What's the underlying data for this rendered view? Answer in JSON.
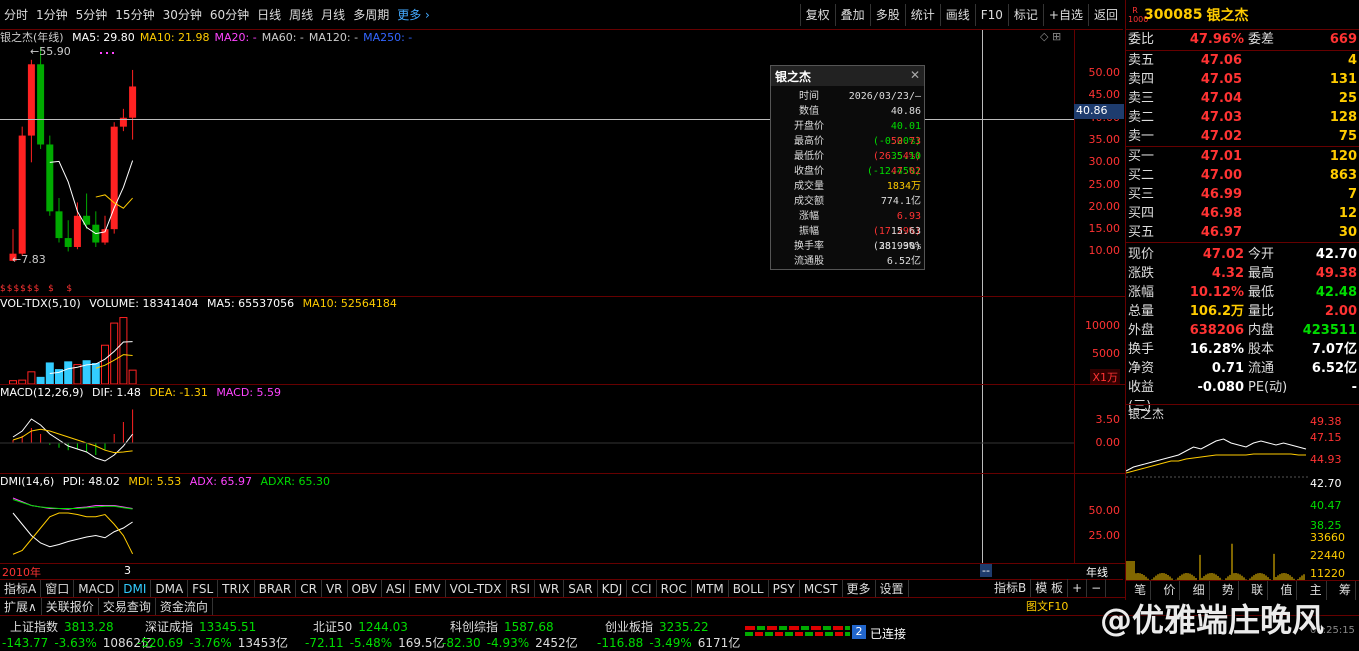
{
  "toolbar": {
    "timeframes": [
      "分时",
      "1分钟",
      "5分钟",
      "15分钟",
      "30分钟",
      "60分钟",
      "日线",
      "周线",
      "月线",
      "多周期"
    ],
    "more": "更多",
    "tools": [
      "复权",
      "叠加",
      "多股",
      "统计",
      "画线",
      "F10",
      "标记",
      "+自选",
      "返回"
    ]
  },
  "main": {
    "name": "银之杰(年线)",
    "ma": [
      {
        "label": "MA5: 29.80",
        "color": "#ffffff"
      },
      {
        "label": "MA10: 21.98",
        "color": "#ffcc00"
      },
      {
        "label": "MA20: -",
        "color": "#ff44ff"
      },
      {
        "label": "MA60: -",
        "color": "#cccccc"
      },
      {
        "label": "MA120: -",
        "color": "#cccccc"
      },
      {
        "label": "MA250: -",
        "color": "#3366ff"
      }
    ],
    "high_label": "55.90",
    "low_label": "7.83",
    "axis": [
      "50.00",
      "45.00",
      "40.00",
      "35.00",
      "30.00",
      "25.00",
      "20.00",
      "15.00",
      "10.00"
    ],
    "cursor_value": "40.86"
  },
  "vol": {
    "title": "VOL-TDX(5,10)",
    "volume": "VOLUME: 18341404",
    "ma5": "MA5: 65537056",
    "ma10": "MA10: 52564184",
    "axis": [
      "10000",
      "5000"
    ],
    "unit": "X1万"
  },
  "macd": {
    "title": "MACD(12,26,9)",
    "dif": "DIF: 1.48",
    "dea": "DEA: -1.31",
    "macd": "MACD: 5.59",
    "axis": [
      "3.50",
      "0.00"
    ]
  },
  "dmi": {
    "title": "DMI(14,6)",
    "pdi": "PDI: 48.02",
    "mdi": "MDI: 5.53",
    "adx": "ADX: 65.97",
    "adxr": "ADXR: 65.30",
    "axis": [
      "50.00",
      "25.00"
    ]
  },
  "xaxis": {
    "start": "2010年",
    "mark": "3",
    "period": "年线"
  },
  "popup": {
    "title": "银之杰",
    "rows": [
      {
        "k": "时间",
        "v": "2026/03/23/—",
        "c": "#dddddd"
      },
      {
        "k": "数值",
        "v": "40.86",
        "c": "#dddddd"
      },
      {
        "k": "开盘价",
        "v": "40.01 (-0.20%)",
        "c": "#00dd00"
      },
      {
        "k": "最高价",
        "v": "50.73 (26.54%)",
        "c": "#ff3333"
      },
      {
        "k": "最低价",
        "v": "35.10 (-12.45%)",
        "c": "#00dd00"
      },
      {
        "k": "收盘价",
        "v": "47.02",
        "c": "#ff3333"
      },
      {
        "k": "成交量",
        "v": "1834万",
        "c": "#ffcc00"
      },
      {
        "k": "成交额",
        "v": "774.1亿",
        "c": "#dddddd"
      },
      {
        "k": "涨幅",
        "v": "6.93 (17.29%)",
        "c": "#ff3333"
      },
      {
        "k": "振幅",
        "v": "15.63 (38.99%)",
        "c": "#dddddd"
      },
      {
        "k": "换手率",
        "v": "281.30%",
        "c": "#dddddd"
      },
      {
        "k": "流通股",
        "v": "6.52亿",
        "c": "#dddddd"
      }
    ]
  },
  "quote": {
    "code": "300085",
    "name": "银之杰",
    "tag_r": "R",
    "tag_l": "1000",
    "wb_label": "委比",
    "wb_value": "47.96%",
    "wc_label": "委差",
    "wc_value": "669",
    "asks": [
      {
        "l": "卖五",
        "p": "47.06",
        "v": "4"
      },
      {
        "l": "卖四",
        "p": "47.05",
        "v": "131"
      },
      {
        "l": "卖三",
        "p": "47.04",
        "v": "25"
      },
      {
        "l": "卖二",
        "p": "47.03",
        "v": "128"
      },
      {
        "l": "卖一",
        "p": "47.02",
        "v": "75"
      }
    ],
    "bids": [
      {
        "l": "买一",
        "p": "47.01",
        "v": "120"
      },
      {
        "l": "买二",
        "p": "47.00",
        "v": "863"
      },
      {
        "l": "买三",
        "p": "46.99",
        "v": "7"
      },
      {
        "l": "买四",
        "p": "46.98",
        "v": "12"
      },
      {
        "l": "买五",
        "p": "46.97",
        "v": "30"
      }
    ],
    "stats": [
      {
        "l1": "现价",
        "v1": "47.02",
        "c1": "#ff3333",
        "l2": "今开",
        "v2": "42.70",
        "c2": "#ffffff"
      },
      {
        "l1": "涨跌",
        "v1": "4.32",
        "c1": "#ff3333",
        "l2": "最高",
        "v2": "49.38",
        "c2": "#ff3333"
      },
      {
        "l1": "涨幅",
        "v1": "10.12%",
        "c1": "#ff3333",
        "l2": "最低",
        "v2": "42.48",
        "c2": "#00dd00"
      },
      {
        "l1": "总量",
        "v1": "106.2万",
        "c1": "#ffcc00",
        "l2": "量比",
        "v2": "2.00",
        "c2": "#ff3333"
      },
      {
        "l1": "外盘",
        "v1": "638206",
        "c1": "#ff3333",
        "l2": "内盘",
        "v2": "423511",
        "c2": "#00dd00"
      },
      {
        "l1": "换手",
        "v1": "16.28%",
        "c1": "#ffffff",
        "l2": "股本",
        "v2": "7.07亿",
        "c2": "#ffffff"
      },
      {
        "l1": "净资",
        "v1": "0.71",
        "c1": "#ffffff",
        "l2": "流通",
        "v2": "6.52亿",
        "c2": "#ffffff"
      },
      {
        "l1": "收益(三)",
        "v1": "-0.080",
        "c1": "#ffffff",
        "l2": "PE(动)",
        "v2": "-",
        "c2": "#ffffff"
      }
    ],
    "mini_name": "银之杰",
    "mini_axis": [
      "49.38",
      "47.15",
      "44.93",
      "42.70",
      "40.47",
      "38.25"
    ],
    "mini_vol_axis": [
      "33660",
      "22440",
      "11220"
    ],
    "bottom_tabs": [
      "笔",
      "价",
      "细",
      "势",
      "联",
      "值",
      "主",
      "筹"
    ]
  },
  "indicator_tabs": [
    "指标A",
    "窗口",
    "MACD",
    "DMI",
    "DMA",
    "FSL",
    "TRIX",
    "BRAR",
    "CR",
    "VR",
    "OBV",
    "ASI",
    "EMV",
    "VOL-TDX",
    "RSI",
    "WR",
    "SAR",
    "KDJ",
    "CCI",
    "ROC",
    "MTM",
    "BOLL",
    "PSY",
    "MCST",
    "更多",
    "设置"
  ],
  "active_indicator": "DMI",
  "indicator_b": "指标B",
  "template": "模 板",
  "bottom_tabs": [
    "扩展∧",
    "关联报价",
    "交易查询",
    "资金流向"
  ],
  "right_bottom_label": "图文F10",
  "status": {
    "indices": [
      {
        "name": "上证指数",
        "val": "3813.28",
        "chg": "-143.77",
        "pct": "-3.63%",
        "amt": "10862亿"
      },
      {
        "name": "深证成指",
        "val": "13345.51",
        "chg": "-520.69",
        "pct": "-3.76%",
        "amt": "13453亿"
      },
      {
        "name": "北证50",
        "val": "1244.03",
        "chg": "-72.11",
        "pct": "-5.48%",
        "amt": "169.5亿"
      },
      {
        "name": "科创综指",
        "val": "1587.68",
        "chg": "-82.30",
        "pct": "-4.93%",
        "amt": "2452亿"
      },
      {
        "name": "创业板指",
        "val": "3235.22",
        "chg": "-116.88",
        "pct": "-3.49%",
        "amt": "6171亿"
      }
    ],
    "conn_num": "2",
    "conn": "已连接",
    "time": "09:25:15"
  },
  "watermark": "@优雅端庄晚风",
  "chart_data": {
    "type": "candlestick",
    "period": "年线",
    "x_start": "2010年",
    "candles": [
      {
        "o": 7.9,
        "h": 15,
        "l": 7.83,
        "c": 9.5
      },
      {
        "o": 9.5,
        "h": 38,
        "l": 9,
        "c": 36
      },
      {
        "o": 36,
        "h": 53,
        "l": 30,
        "c": 52
      },
      {
        "o": 52,
        "h": 55.9,
        "l": 33,
        "c": 34
      },
      {
        "o": 34,
        "h": 36,
        "l": 18,
        "c": 19
      },
      {
        "o": 19,
        "h": 22,
        "l": 12,
        "c": 13
      },
      {
        "o": 13,
        "h": 17,
        "l": 10,
        "c": 11
      },
      {
        "o": 11,
        "h": 21,
        "l": 10.5,
        "c": 18
      },
      {
        "o": 18,
        "h": 23,
        "l": 15,
        "c": 16
      },
      {
        "o": 16,
        "h": 19,
        "l": 11,
        "c": 12
      },
      {
        "o": 12,
        "h": 18,
        "l": 11.5,
        "c": 15
      },
      {
        "o": 15,
        "h": 39,
        "l": 14,
        "c": 38
      },
      {
        "o": 38,
        "h": 42,
        "l": 37,
        "c": 40
      },
      {
        "o": 40.01,
        "h": 50.73,
        "l": 35.1,
        "c": 47.02
      }
    ],
    "ma5": [
      null,
      null,
      null,
      null,
      30,
      30.2,
      25.6,
      19,
      15.4,
      14,
      14.4,
      19.8,
      24.4,
      30.4
    ],
    "ma10": [
      null,
      null,
      null,
      null,
      null,
      null,
      null,
      null,
      null,
      22.2,
      22.7,
      20.9,
      19.7,
      21.98
    ],
    "volume": [
      600,
      700,
      2200,
      1200,
      3800,
      2600,
      4000,
      3500,
      4200,
      3700,
      7000,
      11000,
      12000,
      2500
    ],
    "ylim": [
      0,
      57
    ],
    "axis_ticks": [
      10,
      15,
      20,
      25,
      30,
      35,
      40,
      45,
      50
    ]
  }
}
